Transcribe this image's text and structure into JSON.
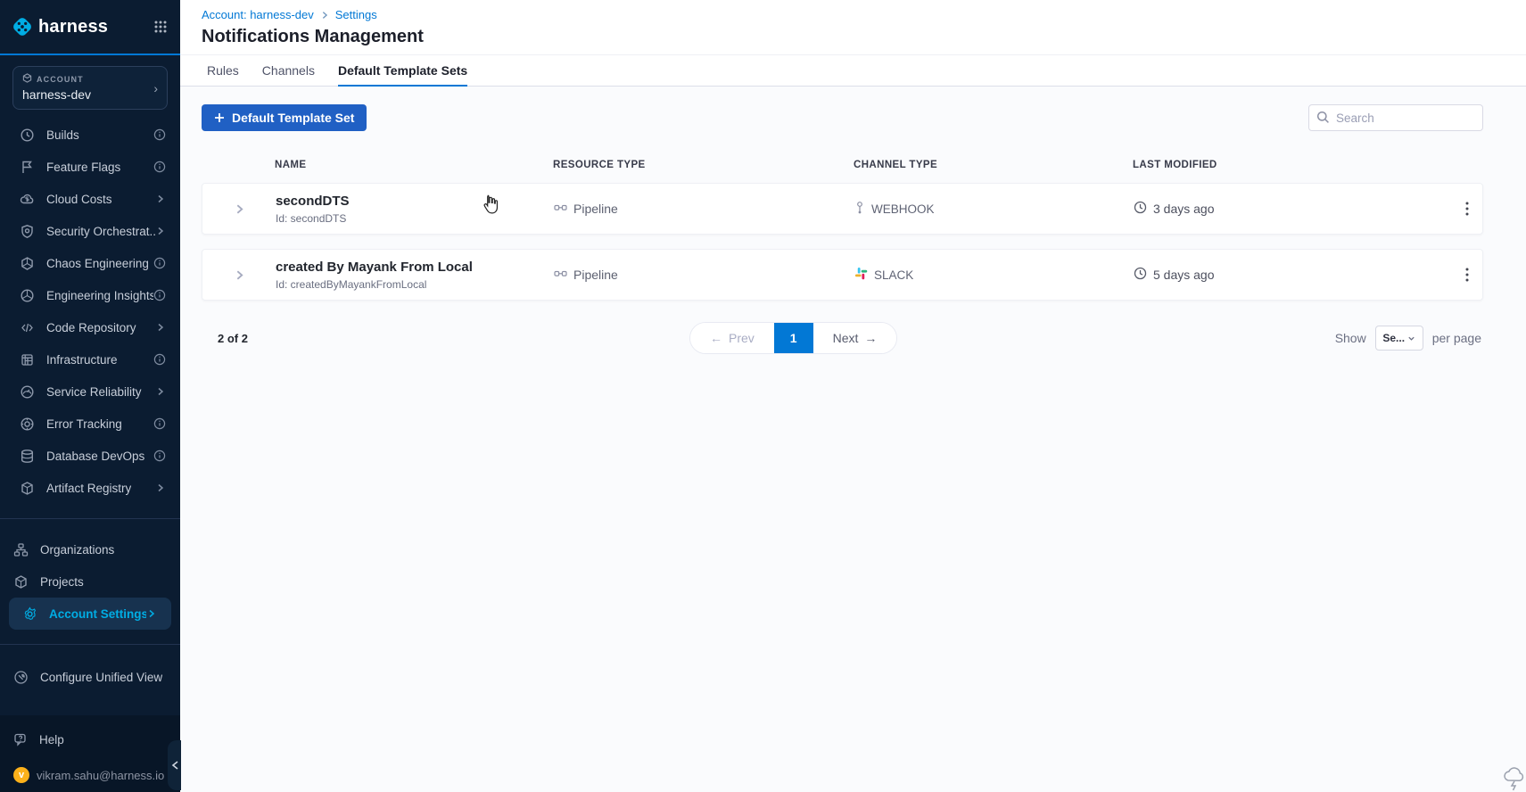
{
  "brand": {
    "logo_text": "harness"
  },
  "account_switcher": {
    "label": "ACCOUNT",
    "value": "harness-dev"
  },
  "sidebar": {
    "items": [
      {
        "label": "Builds",
        "accessory": "info"
      },
      {
        "label": "Feature Flags",
        "accessory": "info"
      },
      {
        "label": "Cloud Costs",
        "accessory": "chevron"
      },
      {
        "label": "Security Orchestrat...",
        "accessory": "chevron"
      },
      {
        "label": "Chaos Engineering",
        "accessory": "info"
      },
      {
        "label": "Engineering Insights",
        "accessory": "info"
      },
      {
        "label": "Code Repository",
        "accessory": "chevron"
      },
      {
        "label": "Infrastructure",
        "accessory": "info"
      },
      {
        "label": "Service Reliability",
        "accessory": "chevron"
      },
      {
        "label": "Error Tracking",
        "accessory": "info"
      },
      {
        "label": "Database DevOps",
        "accessory": "info"
      },
      {
        "label": "Artifact Registry",
        "accessory": "chevron"
      }
    ],
    "secondary": [
      {
        "label": "Organizations"
      },
      {
        "label": "Projects"
      },
      {
        "label": "Account Settings",
        "accessory": "chevron",
        "active": true
      }
    ],
    "tertiary": [
      {
        "label": "Configure Unified View"
      }
    ],
    "footer": {
      "help": "Help",
      "email": "vikram.sahu@harness.io",
      "avatar_initial": "v"
    }
  },
  "header": {
    "breadcrumb": {
      "account": "Account: harness-dev",
      "settings": "Settings"
    },
    "title": "Notifications Management"
  },
  "tabs": [
    {
      "label": "Rules"
    },
    {
      "label": "Channels"
    },
    {
      "label": "Default Template Sets",
      "active": true
    }
  ],
  "toolbar": {
    "new_button": "Default Template Set",
    "search_placeholder": "Search"
  },
  "table": {
    "columns": [
      "NAME",
      "RESOURCE TYPE",
      "CHANNEL TYPE",
      "LAST MODIFIED"
    ],
    "rows": [
      {
        "name": "secondDTS",
        "id": "Id: secondDTS",
        "resource_type": "Pipeline",
        "channel_type": "WEBHOOK",
        "last_modified": "3 days ago"
      },
      {
        "name": "created By Mayank From Local",
        "id": "Id: createdByMayankFromLocal",
        "resource_type": "Pipeline",
        "channel_type": "SLACK",
        "last_modified": "5 days ago"
      }
    ]
  },
  "pagination": {
    "summary": "2 of 2",
    "prev_arrow": "←",
    "prev": "Prev",
    "page": "1",
    "next": "Next",
    "next_arrow": "→",
    "show": "Show",
    "page_size": "Se...",
    "per_page": "per page"
  },
  "colors": {
    "accent_blue": "#0278d5",
    "sidebar_bg": "#0b1c31",
    "active_item_text": "#00ade4",
    "button_blue": "#2060c4",
    "avatar_orange": "#fcb11a",
    "slack_blue": "#36C5F0",
    "slack_green": "#2EB67D",
    "slack_red": "#E01E5A",
    "slack_yellow": "#ECB22E"
  }
}
